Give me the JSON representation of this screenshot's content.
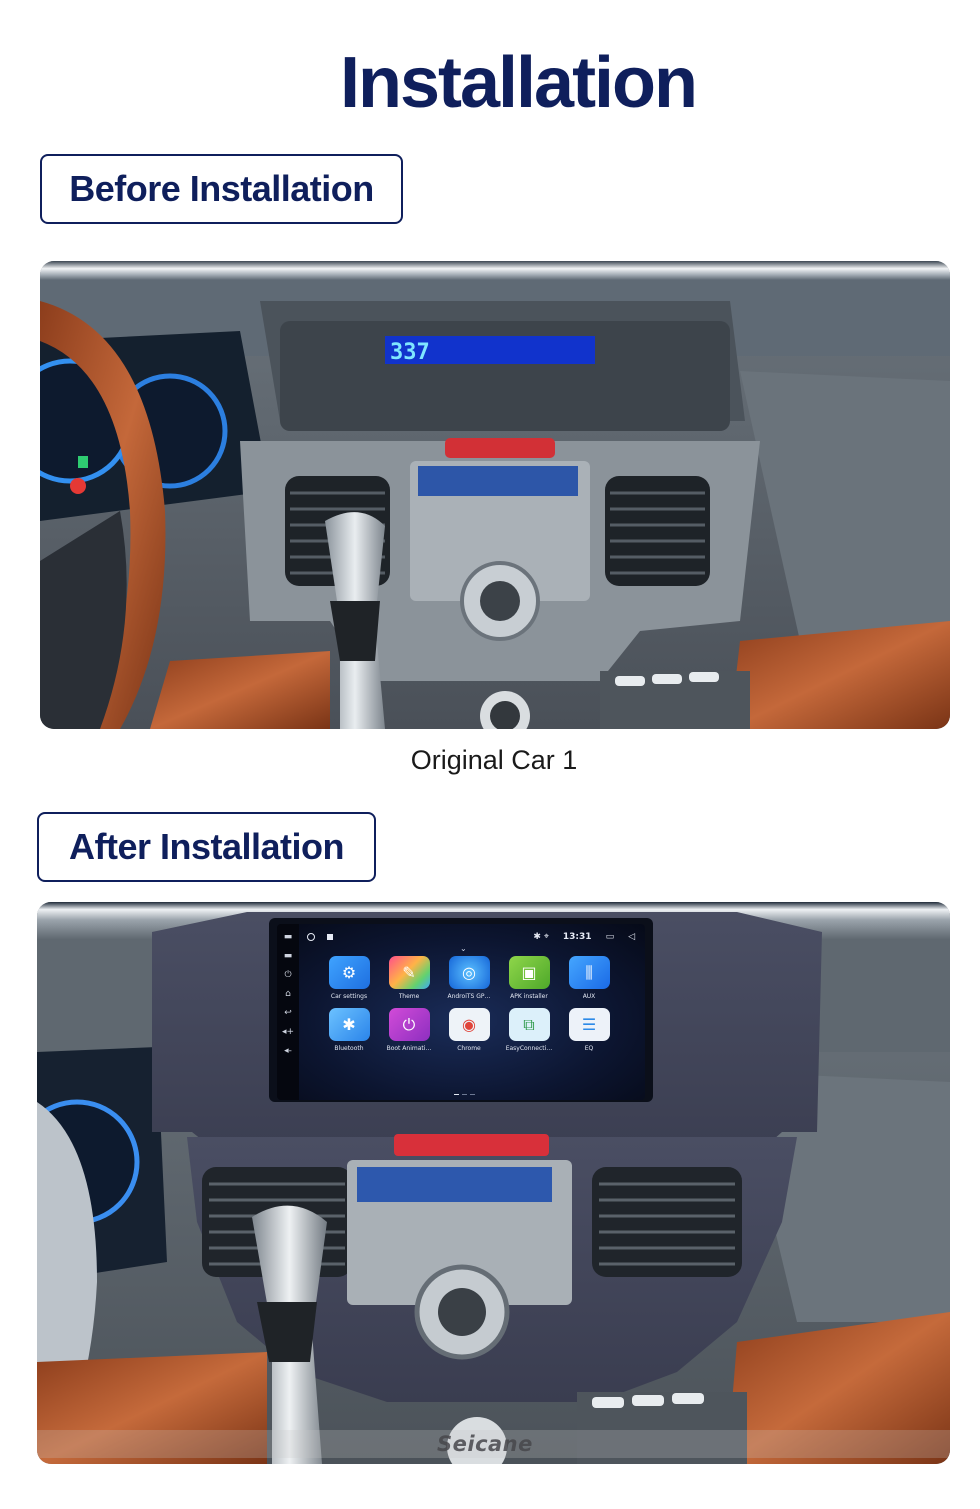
{
  "page": {
    "title": "Installation",
    "brand_color": "#0f1f5c"
  },
  "before": {
    "label": "Before Installation",
    "photo_alt": "Original car dashboard",
    "dash_display": "337",
    "caption": "Original Car  1"
  },
  "after": {
    "label": "After Installation",
    "photo_alt": "Dashboard with Android head unit installed",
    "watermark": "Seicane",
    "head_unit": {
      "status": {
        "time": "13:31",
        "left_icons": [
          "home-circle-icon",
          "gallery-icon"
        ],
        "right_icons": [
          "bluetooth-icon",
          "location-icon",
          "recent-apps-icon",
          "back-icon"
        ]
      },
      "side_buttons": [
        {
          "icon": "mic-icon",
          "glyph": "▬"
        },
        {
          "icon": "rst-icon",
          "glyph": "▬"
        },
        {
          "icon": "power-icon",
          "glyph": "⏻"
        },
        {
          "icon": "home-icon",
          "glyph": "⌂"
        },
        {
          "icon": "back-icon",
          "glyph": "↩"
        },
        {
          "icon": "volume-up-icon",
          "glyph": "◂+"
        },
        {
          "icon": "volume-down-icon",
          "glyph": "◂-"
        }
      ],
      "apps": [
        {
          "label": "Car settings",
          "icon": "car-settings-icon",
          "glyph": "⚙",
          "color": "#2f8df0"
        },
        {
          "label": "Theme",
          "icon": "theme-icon",
          "glyph": "✎",
          "color": "#f05a7a"
        },
        {
          "label": "AndroiTS GP…",
          "icon": "gps-icon",
          "glyph": "◎",
          "color": "#1e88e5"
        },
        {
          "label": "APK installer",
          "icon": "apk-installer-icon",
          "glyph": "▣",
          "color": "#6fbe3e"
        },
        {
          "label": "AUX",
          "icon": "aux-icon",
          "glyph": "⫼",
          "color": "#2a86f0"
        },
        {
          "label": "Bluetooth",
          "icon": "bluetooth-app-icon",
          "glyph": "✱",
          "color": "#4aa8f5"
        },
        {
          "label": "Boot Animati…",
          "icon": "boot-animation-icon",
          "glyph": "⏻",
          "color": "#b43cc8"
        },
        {
          "label": "Chrome",
          "icon": "chrome-icon",
          "glyph": "◉",
          "color": "#e8eef6"
        },
        {
          "label": "EasyConnecti…",
          "icon": "easyconnection-icon",
          "glyph": "⧉",
          "color": "#d8eef9"
        },
        {
          "label": "EQ",
          "icon": "eq-icon",
          "glyph": "☰",
          "color": "#e7eef8"
        }
      ],
      "pages": 3,
      "active_page": 1
    }
  }
}
